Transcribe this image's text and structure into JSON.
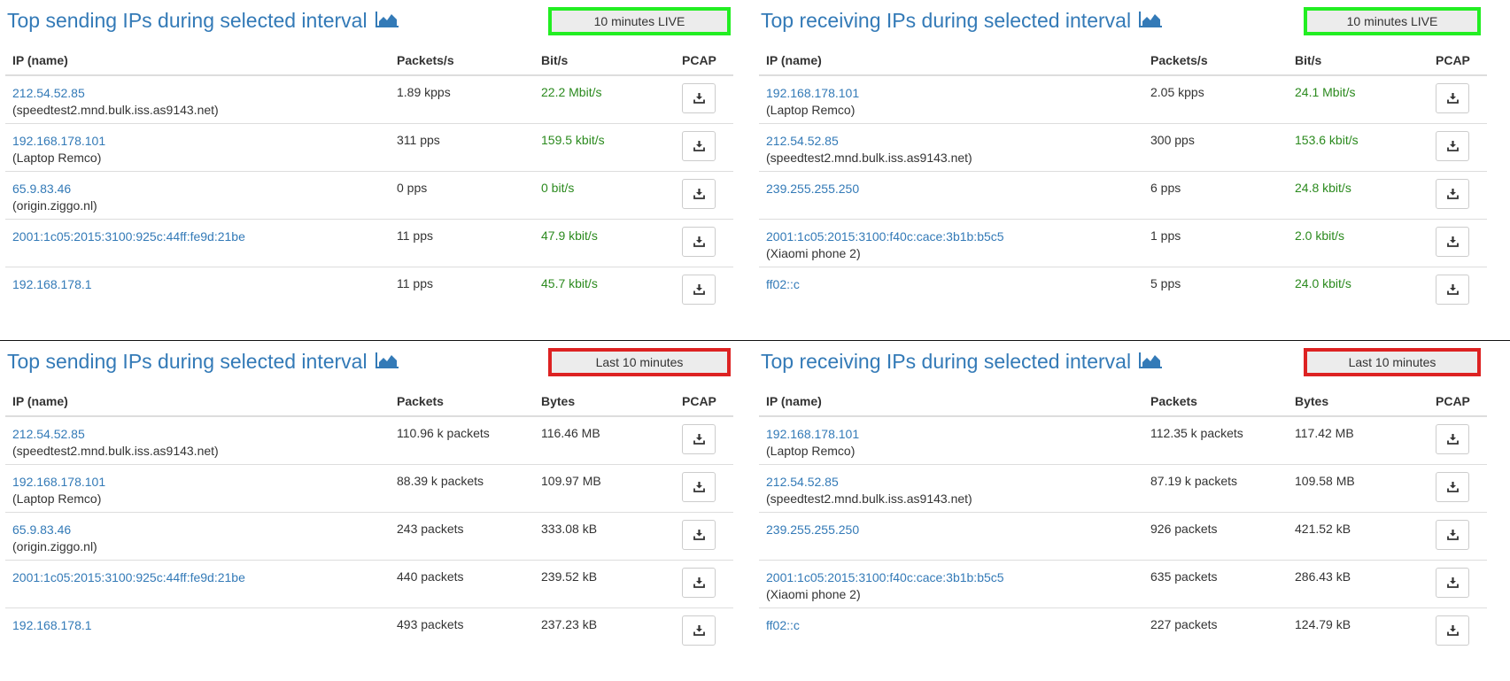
{
  "sections": [
    {
      "panels": [
        {
          "title": "Top sending IPs during selected interval",
          "interval_label": "10 minutes LIVE",
          "interval_style": "live",
          "columns": [
            "IP (name)",
            "Packets/s",
            "Bit/s",
            "PCAP"
          ],
          "rows": [
            {
              "ip": "212.54.52.85",
              "name": "(speedtest2.mnd.bulk.iss.as9143.net)",
              "packets": "1.89 kpps",
              "bits": "22.2 Mbit/s"
            },
            {
              "ip": "192.168.178.101",
              "name": "(Laptop Remco)",
              "packets": "311 pps",
              "bits": "159.5 kbit/s"
            },
            {
              "ip": "65.9.83.46",
              "name": "(origin.ziggo.nl)",
              "packets": "0 pps",
              "bits": "0 bit/s"
            },
            {
              "ip": "2001:1c05:2015:3100:925c:44ff:fe9d:21be",
              "name": "",
              "packets": "11 pps",
              "bits": "47.9 kbit/s"
            },
            {
              "ip": "192.168.178.1",
              "name": "",
              "packets": "11 pps",
              "bits": "45.7 kbit/s"
            }
          ]
        },
        {
          "title": "Top receiving IPs during selected interval",
          "interval_label": "10 minutes LIVE",
          "interval_style": "live",
          "columns": [
            "IP (name)",
            "Packets/s",
            "Bit/s",
            "PCAP"
          ],
          "rows": [
            {
              "ip": "192.168.178.101",
              "name": "(Laptop Remco)",
              "packets": "2.05 kpps",
              "bits": "24.1 Mbit/s"
            },
            {
              "ip": "212.54.52.85",
              "name": "(speedtest2.mnd.bulk.iss.as9143.net)",
              "packets": "300 pps",
              "bits": "153.6 kbit/s"
            },
            {
              "ip": "239.255.255.250",
              "name": "",
              "packets": "6 pps",
              "bits": "24.8 kbit/s"
            },
            {
              "ip": "2001:1c05:2015:3100:f40c:cace:3b1b:b5c5",
              "name": "(Xiaomi phone 2)",
              "packets": "1 pps",
              "bits": "2.0 kbit/s"
            },
            {
              "ip": "ff02::c",
              "name": "",
              "packets": "5 pps",
              "bits": "24.0 kbit/s"
            }
          ]
        }
      ]
    },
    {
      "panels": [
        {
          "title": "Top sending IPs during selected interval",
          "interval_label": "Last 10 minutes",
          "interval_style": "hist",
          "columns": [
            "IP (name)",
            "Packets",
            "Bytes",
            "PCAP"
          ],
          "rows": [
            {
              "ip": "212.54.52.85",
              "name": "(speedtest2.mnd.bulk.iss.as9143.net)",
              "packets": "110.96 k packets",
              "bits": "116.46 MB"
            },
            {
              "ip": "192.168.178.101",
              "name": "(Laptop Remco)",
              "packets": "88.39 k packets",
              "bits": "109.97 MB"
            },
            {
              "ip": "65.9.83.46",
              "name": "(origin.ziggo.nl)",
              "packets": "243 packets",
              "bits": "333.08 kB"
            },
            {
              "ip": "2001:1c05:2015:3100:925c:44ff:fe9d:21be",
              "name": "",
              "packets": "440 packets",
              "bits": "239.52 kB"
            },
            {
              "ip": "192.168.178.1",
              "name": "",
              "packets": "493 packets",
              "bits": "237.23 kB"
            }
          ]
        },
        {
          "title": "Top receiving IPs during selected interval",
          "interval_label": "Last 10 minutes",
          "interval_style": "hist",
          "columns": [
            "IP (name)",
            "Packets",
            "Bytes",
            "PCAP"
          ],
          "rows": [
            {
              "ip": "192.168.178.101",
              "name": "(Laptop Remco)",
              "packets": "112.35 k packets",
              "bits": "117.42 MB"
            },
            {
              "ip": "212.54.52.85",
              "name": "(speedtest2.mnd.bulk.iss.as9143.net)",
              "packets": "87.19 k packets",
              "bits": "109.58 MB"
            },
            {
              "ip": "239.255.255.250",
              "name": "",
              "packets": "926 packets",
              "bits": "421.52 kB"
            },
            {
              "ip": "2001:1c05:2015:3100:f40c:cace:3b1b:b5c5",
              "name": "(Xiaomi phone 2)",
              "packets": "635 packets",
              "bits": "286.43 kB"
            },
            {
              "ip": "ff02::c",
              "name": "",
              "packets": "227 packets",
              "bits": "124.79 kB"
            }
          ]
        }
      ]
    }
  ],
  "colors": {
    "link": "#337ab7",
    "rate_green": "#2b8a1e",
    "live_border": "#22ee22",
    "hist_border": "#dd2222"
  },
  "icons": {
    "title": "area-chart-icon",
    "pcap": "download-icon"
  }
}
